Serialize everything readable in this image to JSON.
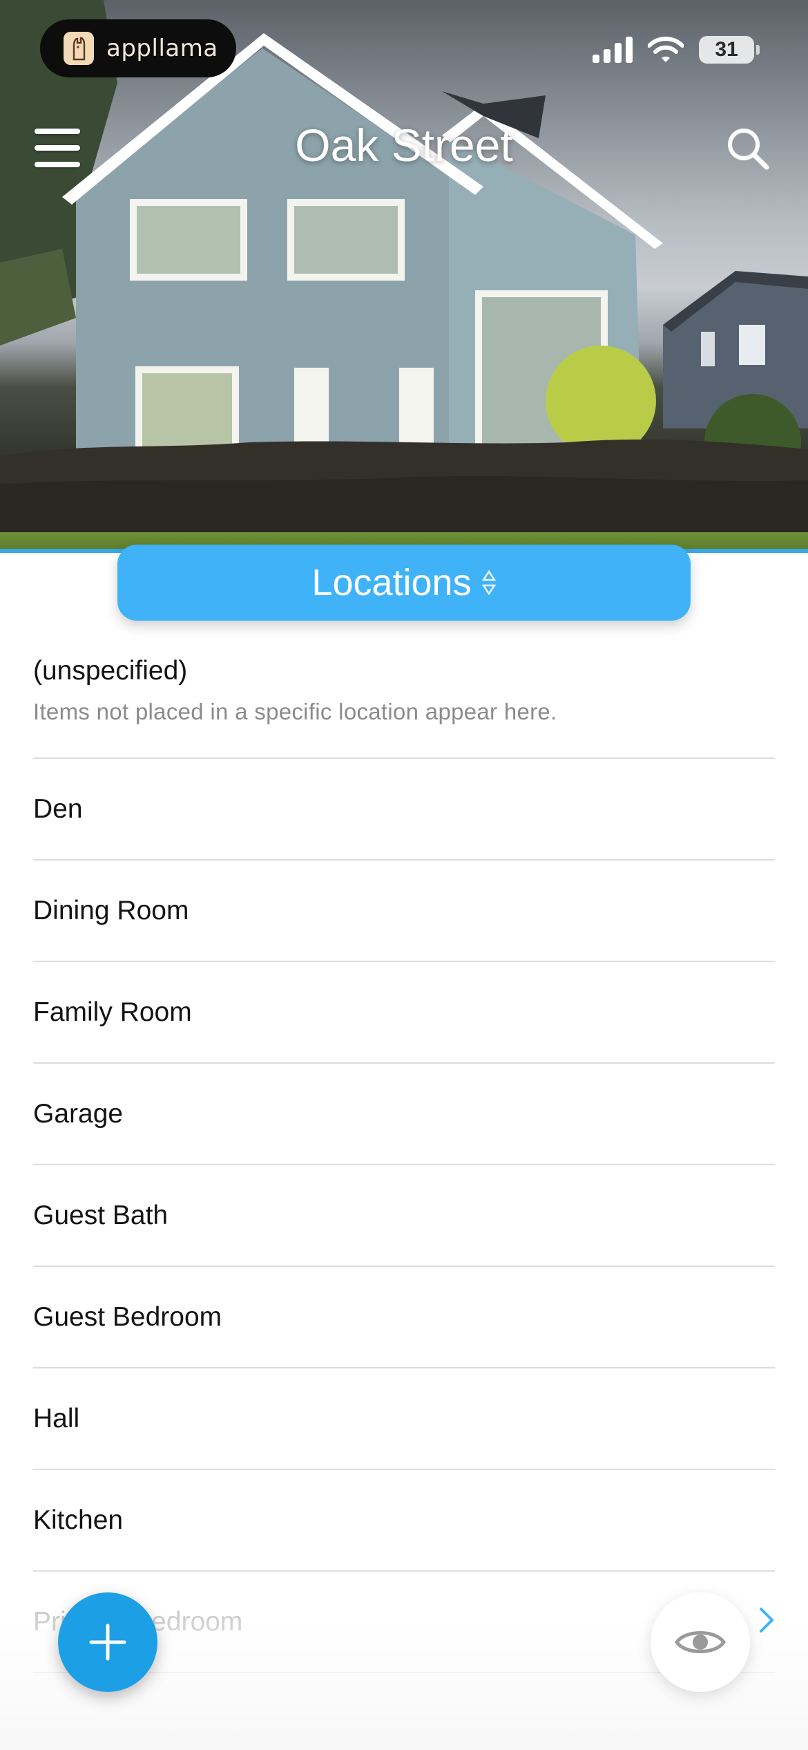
{
  "status_bar": {
    "app_badge_text": "appllama",
    "battery_level": "31",
    "signal_icon": "cellular-signal-icon",
    "wifi_icon": "wifi-icon"
  },
  "header": {
    "title": "Oak Street",
    "menu_icon": "hamburger-menu-icon",
    "search_icon": "search-icon"
  },
  "selector": {
    "label": "Locations",
    "sort_icon": "up-down-arrows-icon"
  },
  "locations": [
    {
      "name": "(unspecified)",
      "description": "Items not placed in a specific location appear here."
    },
    {
      "name": "Den"
    },
    {
      "name": "Dining Room"
    },
    {
      "name": "Family Room"
    },
    {
      "name": "Garage"
    },
    {
      "name": "Guest Bath"
    },
    {
      "name": "Guest Bedroom"
    },
    {
      "name": "Hall"
    },
    {
      "name": "Kitchen"
    },
    {
      "name": "Primary Bedroom"
    }
  ],
  "actions": {
    "add_icon": "plus-icon",
    "view_icon": "eye-icon",
    "chevron_icon": "chevron-right-icon"
  },
  "colors": {
    "accent": "#40b3f8",
    "fab": "#1d9fe6"
  }
}
